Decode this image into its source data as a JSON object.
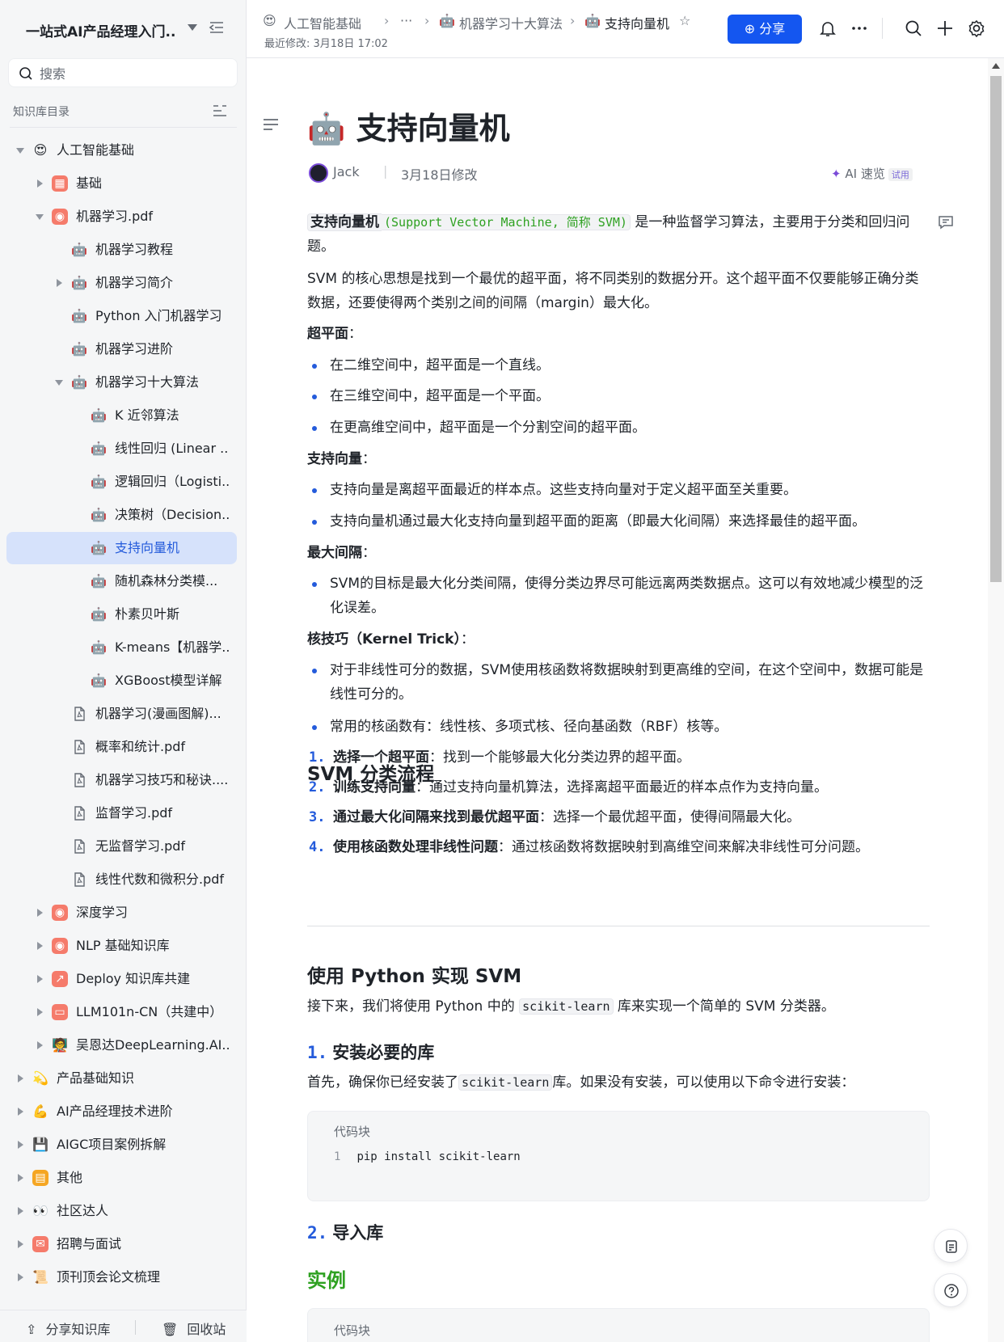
{
  "sidebar": {
    "kb_title": "一站式AI产品经理入门...",
    "search_placeholder": "搜索",
    "dir_label": "知识库目录",
    "tree": [
      {
        "label": "人工智能基础",
        "emoji": "😍",
        "indent": 0,
        "caret": "down"
      },
      {
        "label": "基础",
        "emoji": "▦",
        "indent": 1,
        "caret": "right",
        "color": "#f57b6b"
      },
      {
        "label": "机器学习.pdf",
        "emoji": "◉",
        "indent": 1,
        "caret": "down",
        "color": "#f57b6b"
      },
      {
        "label": "机器学习教程",
        "emoji": "🤖",
        "indent": 2,
        "caret": ""
      },
      {
        "label": "机器学习简介",
        "emoji": "🤖",
        "indent": 2,
        "caret": "right"
      },
      {
        "label": "Python 入门机器学习",
        "emoji": "🤖",
        "indent": 2,
        "caret": ""
      },
      {
        "label": "机器学习进阶",
        "emoji": "🤖",
        "indent": 2,
        "caret": ""
      },
      {
        "label": "机器学习十大算法",
        "emoji": "🤖",
        "indent": 2,
        "caret": "down"
      },
      {
        "label": "K 近邻算法",
        "emoji": "🤖",
        "indent": 3,
        "caret": ""
      },
      {
        "label": "线性回归 (Linear ...",
        "emoji": "🤖",
        "indent": 3,
        "caret": ""
      },
      {
        "label": "逻辑回归（Logisti...",
        "emoji": "🤖",
        "indent": 3,
        "caret": ""
      },
      {
        "label": "决策树（Decision...",
        "emoji": "🤖",
        "indent": 3,
        "caret": ""
      },
      {
        "label": "支持向量机",
        "emoji": "🤖",
        "indent": 3,
        "caret": "",
        "selected": true
      },
      {
        "label": "随机森林分类模...",
        "emoji": "🤖",
        "indent": 3,
        "caret": ""
      },
      {
        "label": "朴素贝叶斯",
        "emoji": "🤖",
        "indent": 3,
        "caret": ""
      },
      {
        "label": "K-means【机器学...",
        "emoji": "🤖",
        "indent": 3,
        "caret": ""
      },
      {
        "label": "XGBoost模型详解",
        "emoji": "🤖",
        "indent": 3,
        "caret": ""
      },
      {
        "label": "机器学习(漫画图解)...",
        "emoji": "pdf",
        "indent": 2,
        "caret": ""
      },
      {
        "label": "概率和统计.pdf",
        "emoji": "pdf",
        "indent": 2,
        "caret": ""
      },
      {
        "label": "机器学习技巧和秘诀....",
        "emoji": "pdf",
        "indent": 2,
        "caret": ""
      },
      {
        "label": "监督学习.pdf",
        "emoji": "pdf",
        "indent": 2,
        "caret": ""
      },
      {
        "label": "无监督学习.pdf",
        "emoji": "pdf",
        "indent": 2,
        "caret": ""
      },
      {
        "label": "线性代数和微积分.pdf",
        "emoji": "pdf",
        "indent": 2,
        "caret": ""
      },
      {
        "label": "深度学习",
        "emoji": "◉",
        "indent": 1,
        "caret": "right",
        "color": "#f57b6b"
      },
      {
        "label": "NLP 基础知识库",
        "emoji": "◉",
        "indent": 1,
        "caret": "right",
        "color": "#f57b6b"
      },
      {
        "label": "Deploy 知识库共建",
        "emoji": "↗",
        "indent": 1,
        "caret": "right",
        "color": "#f57b6b"
      },
      {
        "label": "LLM101n-CN（共建中）",
        "emoji": "▭",
        "indent": 1,
        "caret": "right",
        "color": "#f57b6b"
      },
      {
        "label": "吴恩达DeepLearning.AI...",
        "emoji": "🧑‍🏫",
        "indent": 1,
        "caret": "right"
      },
      {
        "label": "产品基础知识",
        "emoji": "💫",
        "indent": 0,
        "caret": "right"
      },
      {
        "label": "AI产品经理技术进阶",
        "emoji": "💪",
        "indent": 0,
        "caret": "right"
      },
      {
        "label": "AIGC项目案例拆解",
        "emoji": "💾",
        "indent": 0,
        "caret": "right"
      },
      {
        "label": "其他",
        "emoji": "▤",
        "indent": 0,
        "caret": "right",
        "color": "#f5a623"
      },
      {
        "label": "社区达人",
        "emoji": "👀",
        "indent": 0,
        "caret": "right"
      },
      {
        "label": "招聘与面试",
        "emoji": "✉",
        "indent": 0,
        "caret": "right",
        "color": "#f57b6b"
      },
      {
        "label": "顶刊顶会论文梳理",
        "emoji": "📜",
        "indent": 0,
        "caret": "right"
      }
    ],
    "footer": {
      "share_kb": "分享知识库",
      "recycle": "回收站"
    }
  },
  "topbar": {
    "breadcrumbs": [
      {
        "emoji": "😍",
        "label": "人工智能基础"
      },
      {
        "label": "···"
      },
      {
        "emoji": "🤖",
        "label": "机器学习十大算法"
      },
      {
        "emoji": "🤖",
        "label": "支持向量机"
      }
    ],
    "last_modified": "最近修改: 3月18日 17:02",
    "share_label": "分享"
  },
  "doc": {
    "title_emoji": "🤖",
    "title": "支持向量机",
    "author": "Jack",
    "modified": "3月18日修改",
    "ai_read": "AI 速览",
    "trial": "试用",
    "intro_bold": "支持向量机",
    "intro_code": "(Support Vector Machine, 简称 SVM)",
    "intro_rest": "是一种监督学习算法，主要用于分类和回归问题。",
    "p2": "SVM 的核心思想是找到一个最优的超平面，将不同类别的数据分开。这个超平面不仅要能够正确分类数据，还要使得两个类别之间的间隔（margin）最大化。",
    "s1_title": "超平面",
    "s1_items": [
      "在二维空间中，超平面是一个直线。",
      "在三维空间中，超平面是一个平面。",
      "在更高维空间中，超平面是一个分割空间的超平面。"
    ],
    "s2_title": "支持向量",
    "s2_items": [
      "支持向量是离超平面最近的样本点。这些支持向量对于定义超平面至关重要。",
      "支持向量机通过最大化支持向量到超平面的距离（即最大化间隔）来选择最佳的超平面。"
    ],
    "s3_title": "最大间隔",
    "s3_items": [
      "SVM的目标是最大化分类间隔，使得分类边界尽可能远离两类数据点。这可以有效地减少模型的泛化误差。"
    ],
    "s4_title": "核技巧（Kernel Trick）",
    "s4_items": [
      "对于非线性可分的数据，SVM使用核函数将数据映射到更高维的空间，在这个空间中，数据可能是线性可分的。",
      "常用的核函数有：线性核、多项式核、径向基函数（RBF）核等。"
    ],
    "flow_title": "SVM 分类流程",
    "flow": [
      {
        "n": "1.",
        "b": "选择一个超平面",
        "t": "：找到一个能够最大化分类边界的超平面。"
      },
      {
        "n": "2.",
        "b": "训练支持向量",
        "t": "：通过支持向量机算法，选择离超平面最近的样本点作为支持向量。"
      },
      {
        "n": "3.",
        "b": "通过最大化间隔来找到最优超平面",
        "t": "：选择一个最优超平面，使得间隔最大化。"
      },
      {
        "n": "4.",
        "b": "使用核函数处理非线性问题",
        "t": "：通过核函数将数据映射到高维空间来解决非线性可分问题。"
      }
    ],
    "py_title": "使用 Python 实现 SVM",
    "py_intro_a": "接下来，我们将使用 Python 中的",
    "py_intro_code": "scikit-learn",
    "py_intro_b": "库来实现一个简单的 SVM 分类器。",
    "step1_n": "1.",
    "step1": "安装必要的库",
    "step1_text_a": "首先，确保你已经安装了",
    "step1_code": "scikit-learn",
    "step1_text_b": "库。如果没有安装，可以使用以下命令进行安装：",
    "codeblock_label": "代码块",
    "code_line_no": "1",
    "code_line": "pip install scikit-learn",
    "step2_n": "2.",
    "step2": "导入库",
    "example": "实例",
    "codeblock2_label": "代码块"
  }
}
